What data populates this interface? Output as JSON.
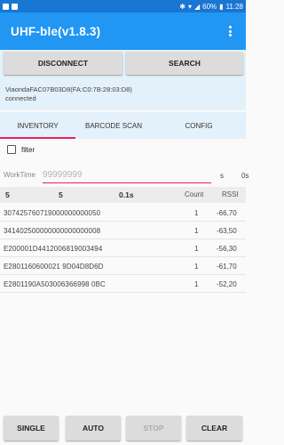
{
  "statusbar": {
    "battery": "60%",
    "time": "11:28"
  },
  "appbar": {
    "title": "UHF-ble(v1.8.3)"
  },
  "connection": {
    "disconnect_label": "DISCONNECT",
    "search_label": "SEARCH",
    "device": "ViaondaFAC07B03D8(FA:C0:7B:28:03:D8)",
    "status": "connected"
  },
  "tabs": [
    {
      "label": "INVENTORY",
      "active": true
    },
    {
      "label": "BARCODE SCAN",
      "active": false
    },
    {
      "label": "CONFIG",
      "active": false
    }
  ],
  "filter": {
    "label": "filter",
    "checked": false
  },
  "worktime": {
    "label": "WorkTime",
    "placeholder": "99999999",
    "unit": "s",
    "extra": "0s"
  },
  "stats": {
    "tags": "5",
    "reads": "5",
    "time": "0.1s",
    "count_header": "Count",
    "rssi_header": "RSSI"
  },
  "tag_list": [
    {
      "epc": "307425760719000000000050",
      "count": "1",
      "rssi": "-66,70"
    },
    {
      "epc": "341402500000000000000008",
      "count": "1",
      "rssi": "-63,50"
    },
    {
      "epc": "E200001D4412006819003494",
      "count": "1",
      "rssi": "-56,30"
    },
    {
      "epc": "E2801160600021 9D04D8D6D",
      "count": "1",
      "rssi": "-61,70"
    },
    {
      "epc": "E2801190A503006366998 0BC",
      "count": "1",
      "rssi": "-52,20"
    }
  ],
  "actions": {
    "single": "SINGLE",
    "auto": "AUTO",
    "stop": "STOP",
    "clear": "CLEAR"
  },
  "colors": {
    "appbar": "#2196f3",
    "statusbar": "#1976d2",
    "accent": "#e91e63",
    "panel": "#e3f1fa"
  }
}
